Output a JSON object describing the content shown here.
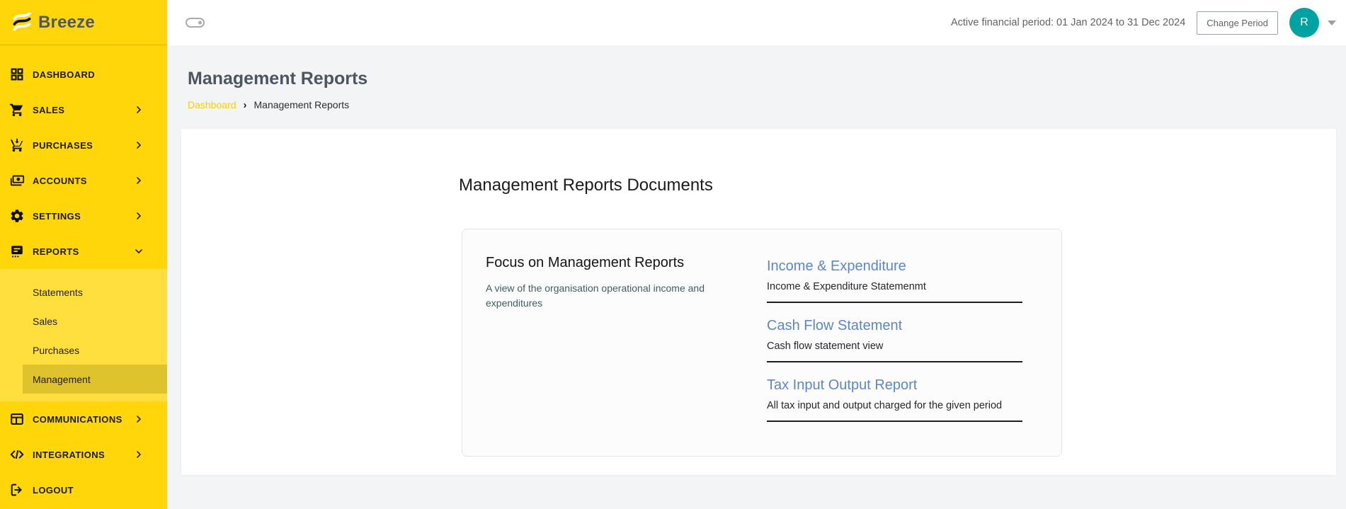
{
  "topbar": {
    "active_period": "Active financial period: 01 Jan 2024 to 31 Dec 2024",
    "change_period_button": "Change Period",
    "avatar_initial": "R"
  },
  "sidebar": {
    "logo_text": "Breeze",
    "items": [
      {
        "label": "DASHBOARD",
        "icon": "dashboard-grid-icon"
      },
      {
        "label": "SALES",
        "icon": "cart-icon"
      },
      {
        "label": "PURCHASES",
        "icon": "cart-arrow-down-icon"
      },
      {
        "label": "ACCOUNTS",
        "icon": "payments-icon"
      },
      {
        "label": "SETTINGS",
        "icon": "gear-icon"
      },
      {
        "label": "REPORTS",
        "icon": "report-icon",
        "expanded": true
      },
      {
        "label": "COMMUNICATIONS",
        "icon": "table-icon"
      },
      {
        "label": "INTEGRATIONS",
        "icon": "code-icon"
      },
      {
        "label": "LOGOUT",
        "icon": "logout-icon"
      }
    ],
    "reports_submenu": [
      {
        "label": "Statements"
      },
      {
        "label": "Sales"
      },
      {
        "label": "Purchases"
      },
      {
        "label": "Management",
        "active": true
      }
    ]
  },
  "page": {
    "title": "Management Reports",
    "breadcrumb": {
      "parent": "Dashboard",
      "separator": "›",
      "current": "Management Reports"
    },
    "section_title": "Management Reports Documents",
    "focus_card": {
      "heading": "Focus on Management Reports",
      "description": "A view of the organisation operational income and expenditures"
    },
    "report_links": [
      {
        "title": "Income & Expenditure",
        "description": "Income & Expenditure Statemenmt"
      },
      {
        "title": "Cash Flow Statement",
        "description": "Cash flow statement view"
      },
      {
        "title": "Tax Input Output Report",
        "description": "All tax input and output charged for the given period"
      }
    ]
  },
  "colors": {
    "sidebar_yellow": "#FFD60A",
    "submenu_yellow": "#FFDF3D",
    "active_item_yellow": "#DFC32D",
    "link_blue": "#5B87CA",
    "avatar_teal": "#00A3A1",
    "breadcrumb_yellow": "#F9CD0C"
  }
}
